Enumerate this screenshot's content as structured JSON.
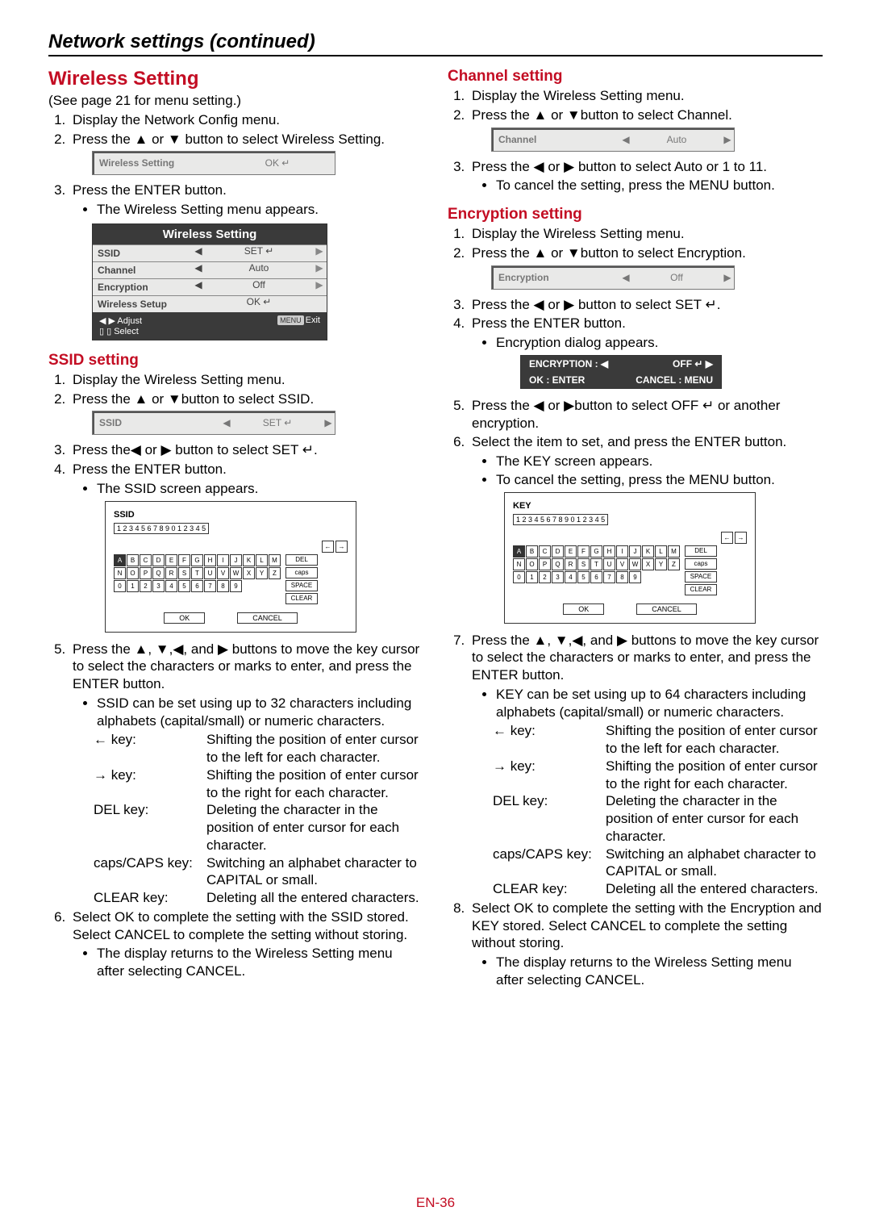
{
  "page": {
    "section_title": "Network settings (continued)",
    "footer": "EN-36"
  },
  "left": {
    "h_wireless": "Wireless Setting",
    "see_page": "(See page 21 for menu setting.)",
    "step1": "Display the Network Config menu.",
    "step2": "Press the ▲ or ▼ button to select Wireless Setting.",
    "img1_label": "Wireless Setting",
    "img1_val": "OK ↵",
    "step3": "Press the ENTER button.",
    "step3b": "The Wireless Setting menu appears.",
    "ws_head": "Wireless Setting",
    "ws_rows": [
      {
        "label": "SSID",
        "mid": "◀",
        "val": "SET ↵",
        "end": "▶"
      },
      {
        "label": "Channel",
        "mid": "◀",
        "val": "Auto",
        "end": "▶"
      },
      {
        "label": "Encryption",
        "mid": "◀",
        "val": "Off",
        "end": "▶"
      },
      {
        "label": "Wireless Setup",
        "mid": "",
        "val": "OK ↵",
        "end": ""
      }
    ],
    "ws_foot_l": "◀ ▶ Adjust",
    "ws_foot_r": "MENU Exit",
    "ws_foot_l2": "▯ ▯ Select",
    "h_ssid": "SSID setting",
    "ssid_s1": "Display the Wireless Setting menu.",
    "ssid_s2": "Press the ▲ or ▼button to select SSID.",
    "ssid_line_label": "SSID",
    "ssid_line_val": "SET ↵",
    "ssid_s3": "Press the◀ or ▶ button to select SET ↵.",
    "ssid_s4": "Press the ENTER button.",
    "ssid_s4b": "The SSID screen appears.",
    "kb": {
      "title": "SSID",
      "input": "1 2 3 4 5 6 7 8 9 0 1 2 3 4 5",
      "r1": [
        "A",
        "B",
        "C",
        "D",
        "E",
        "F",
        "G",
        "H",
        "I",
        "J",
        "K",
        "L",
        "M"
      ],
      "r2": [
        "N",
        "O",
        "P",
        "Q",
        "R",
        "S",
        "T",
        "U",
        "V",
        "W",
        "X",
        "Y",
        "Z"
      ],
      "r3": [
        "0",
        "1",
        "2",
        "3",
        "4",
        "5",
        "6",
        "7",
        "8",
        "9"
      ],
      "arrows": [
        "←",
        "→"
      ],
      "side": [
        "DEL",
        "caps",
        "SPACE",
        "CLEAR"
      ],
      "ok": "OK",
      "cancel": "CANCEL"
    },
    "s5": "Press the ▲, ▼,◀, and ▶ buttons to move the key cursor to select the characters or marks to enter, and press the ENTER button.",
    "s5b": "SSID can be set using up to 32 characters including alphabets (capital/small) or numeric characters.",
    "keys": [
      {
        "k": "← key:",
        "v": "Shifting the position of enter cursor to the left for each character."
      },
      {
        "k": "→ key:",
        "v": "Shifting the position of enter cursor to the right for each character."
      },
      {
        "k": "DEL key:",
        "v": "Deleting the character in the position of enter cursor for each character."
      },
      {
        "k": "caps/CAPS key:",
        "v": "Switching an alphabet character to CAPITAL or small."
      },
      {
        "k": "CLEAR key:",
        "v": "Deleting all the entered characters."
      }
    ],
    "s6": "Select OK to complete the setting with the SSID stored. Select CANCEL to complete the setting without storing.",
    "s6b": "The display returns to the Wireless Setting menu after selecting CANCEL."
  },
  "right": {
    "h_channel": "Channel setting",
    "ch_s1": "Display the Wireless Setting menu.",
    "ch_s2": "Press the ▲ or ▼button to select Channel.",
    "ch_line_label": "Channel",
    "ch_line_val": "Auto",
    "ch_s3": "Press the ◀ or ▶ button to select Auto or 1 to 11.",
    "ch_s3b": "To cancel the setting, press the MENU button.",
    "h_enc": "Encryption setting",
    "en_s1": "Display the Wireless Setting menu.",
    "en_s2": "Press the ▲ or ▼button to select Encryption.",
    "en_line_label": "Encryption",
    "en_line_val": "Off",
    "en_s3": "Press the ◀ or ▶ button to select SET ↵.",
    "en_s4": "Press the ENTER button.",
    "en_s4b": "Encryption dialog appears.",
    "dlg_r1a": "ENCRYPTION :   ◀",
    "dlg_r1b": "OFF ↵          ▶",
    "dlg_r2a": "OK : ENTER",
    "dlg_r2b": "CANCEL : MENU",
    "en_s5": "Press the ◀ or ▶button to select OFF ↵ or another encryption.",
    "en_s6": "Select the item to set, and press the ENTER button.",
    "en_s6b1": "The KEY screen appears.",
    "en_s6b2": "To cancel the setting, press the MENU button.",
    "kb": {
      "title": "KEY",
      "input": "1 2 3 4 5 6 7 8 9 0 1 2 3 4 5"
    },
    "en_s7": "Press the ▲, ▼,◀, and ▶ buttons to move the key cursor to select the characters or marks to enter, and press the ENTER button.",
    "en_s7b": "KEY can be set using up to 64 characters including alphabets (capital/small) or numeric characters.",
    "en_s8": "Select OK to complete the setting with the Encryption and KEY stored. Select CANCEL to complete the setting without storing.",
    "en_s8b": "The display returns to the Wireless Setting menu after selecting CANCEL."
  }
}
